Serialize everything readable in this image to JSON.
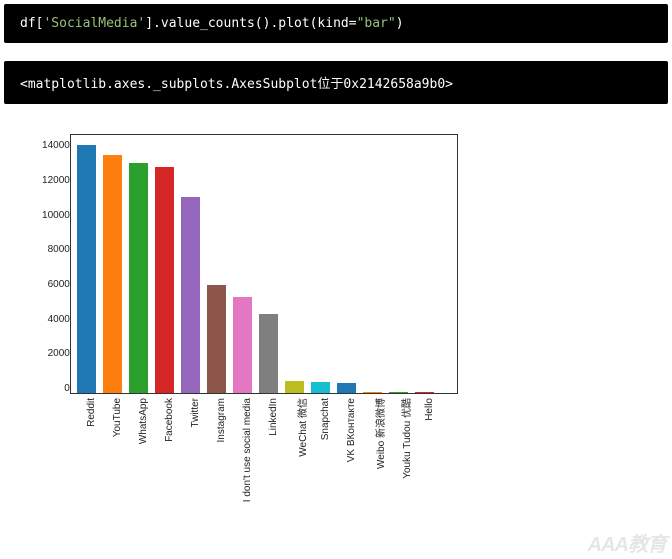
{
  "code_cell": {
    "tokens": [
      {
        "t": "df[",
        "c": "tok-plain"
      },
      {
        "t": "'SocialMedia'",
        "c": "tok-str"
      },
      {
        "t": "].value_counts().plot(kind=",
        "c": "tok-plain"
      },
      {
        "t": "\"bar\"",
        "c": "tok-str"
      },
      {
        "t": ")",
        "c": "tok-plain"
      }
    ]
  },
  "output_cell": {
    "text": "<matplotlib.axes._subplots.AxesSubplot位于0x2142658a9b0>"
  },
  "chart_data": {
    "type": "bar",
    "categories": [
      "Reddit",
      "YouTube",
      "WhatsApp",
      "Facebook",
      "Twitter",
      "Instagram",
      "I don't use social media",
      "LinkedIn",
      "WeChat 微信",
      "Snapchat",
      "VK ВКонтакте",
      "Weibo 新浪微博",
      "Youku Tudou 优酷",
      "Hello"
    ],
    "values": [
      14400,
      13850,
      13400,
      13150,
      11400,
      6300,
      5600,
      4600,
      700,
      650,
      600,
      80,
      50,
      30
    ],
    "colors": [
      "#1f77b4",
      "#ff7f0e",
      "#2ca02c",
      "#d62728",
      "#9467bd",
      "#8c564b",
      "#e377c2",
      "#7f7f7f",
      "#bcbd22",
      "#17becf",
      "#1f77b4",
      "#ff7f0e",
      "#2ca02c",
      "#d62728"
    ],
    "ylim": [
      0,
      15000
    ],
    "yticks": [
      0,
      2000,
      4000,
      6000,
      8000,
      10000,
      12000,
      14000
    ],
    "title": "",
    "xlabel": "",
    "ylabel": ""
  },
  "watermark": "AAA教育"
}
